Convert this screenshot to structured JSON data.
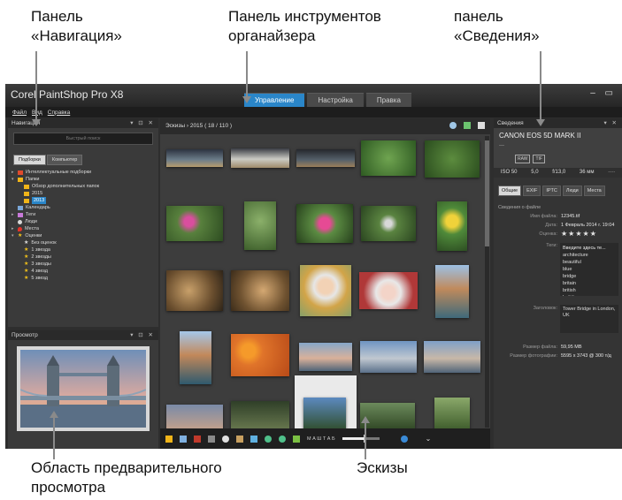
{
  "callouts": {
    "navigation_panel": "Панель\n«Навигация»",
    "organizer_toolbar": "Панель инструментов\nорганайзера",
    "info_panel": "панель\n«Сведения»",
    "preview_area": "Область предварительного\nпросмотра",
    "thumbnails": "Эскизы"
  },
  "app": {
    "title": "Corel PaintShop Pro X8",
    "tabs": [
      "Управление",
      "Настройка",
      "Правка"
    ],
    "active_tab": "Управление",
    "window_controls": "– ▭",
    "menu": [
      "Файл",
      "Вид",
      "Справка"
    ]
  },
  "navigation": {
    "header": "Навигация",
    "header_controls": "▾ ⊡ ✕",
    "search_placeholder": "Быстрый поиск",
    "segments": [
      "Подборки",
      "Компьютер"
    ],
    "tree": [
      {
        "arrow": "▸",
        "icon": "smart-collections-icon",
        "label": "Интеллектуальные подборки"
      },
      {
        "arrow": "▾",
        "icon": "folder-icon",
        "label": "Папки"
      },
      {
        "arrow": "",
        "icon": "browse-folders-icon",
        "label": "Обзор дополнительных папок"
      },
      {
        "arrow": "",
        "icon": "folder-icon",
        "label": "2015"
      },
      {
        "arrow": "",
        "icon": "folder-icon",
        "label": "2013"
      },
      {
        "arrow": "",
        "icon": "calendar-icon",
        "label": "Календарь"
      },
      {
        "arrow": "▸",
        "icon": "tag-icon",
        "label": "Теги"
      },
      {
        "arrow": "",
        "icon": "people-icon",
        "label": "Люди"
      },
      {
        "arrow": "▸",
        "icon": "places-icon",
        "label": "Места"
      },
      {
        "arrow": "▾",
        "icon": "star-icon",
        "label": "Оценки"
      },
      {
        "arrow": "",
        "icon": "star-icon",
        "label": "Без оценок"
      },
      {
        "arrow": "",
        "icon": "star-icon",
        "label": "1 звезда"
      },
      {
        "arrow": "",
        "icon": "star-icon",
        "label": "2 звезды"
      },
      {
        "arrow": "",
        "icon": "star-icon",
        "label": "3 звезды"
      },
      {
        "arrow": "",
        "icon": "star-icon",
        "label": "4 звезд"
      },
      {
        "arrow": "",
        "icon": "star-icon",
        "label": "5 звезд"
      }
    ]
  },
  "preview": {
    "header": "Просмотр",
    "header_controls": "▾ ⊡ ✕"
  },
  "browser": {
    "breadcrumb": "Эскизы  ›  2015  ( 18 / 110 )",
    "zoom_label": "М А Ш Т А Б",
    "zoom_level": 0.6
  },
  "info": {
    "header": "Сведения",
    "header_controls": "▾ ✕",
    "camera": "CANON EOS 5D MARK II",
    "camera_sub": "---",
    "badges": [
      "RAW",
      "TIF"
    ],
    "exposure": [
      "ISO 50",
      "5,0",
      "f/13,0",
      "36 мм",
      "····"
    ],
    "tabs": [
      "Общие",
      "EXIF",
      "IPTC",
      "Люди",
      "Места"
    ],
    "section": "Сведения о файле",
    "file_name_label": "Имя файла:",
    "file_name": "12345.tif",
    "date_label": "Дата:",
    "date": "1 Февраль 2014 г. 19:04",
    "rating_label": "Оценка:",
    "rating": "★★★★★",
    "tags_label": "Теги:",
    "tags_placeholder": "Введите здесь те...",
    "tags": [
      "architecture",
      "beautiful",
      "blue",
      "bridge",
      "britain",
      "british",
      "building"
    ],
    "title_label": "Заголовок:",
    "title_value": "Tower Bridge in London, UK",
    "filesize_label": "Размер файла:",
    "filesize": "59,95 MB",
    "photosize_label": "Размер фотографии:",
    "photosize": "5595 x 3743 @ 300 т/д"
  },
  "colors": {
    "accent": "#2a86c9",
    "panel": "#3a3a3a",
    "toolbar": "#1f1f1f"
  }
}
